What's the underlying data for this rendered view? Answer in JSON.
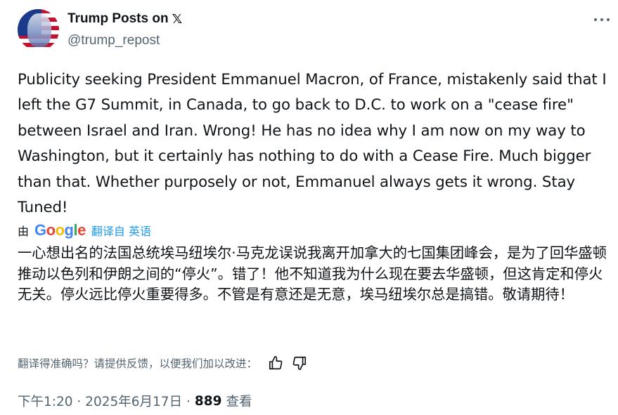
{
  "author": {
    "name": "Trump Posts on",
    "x_logo": "𝕏",
    "handle": "@trump_repost"
  },
  "post": {
    "text": "Publicity seeking President Emmanuel Macron, of France, mistakenly said that I left the G7 Summit, in Canada, to go back to D.C. to work on a \"cease fire\" between Israel and Iran. Wrong! He has no idea why I am now on my way to Washington, but it certainly has nothing to do with a Cease Fire. Much bigger than that. Whether purposely or not, Emmanuel always gets it wrong. Stay Tuned!"
  },
  "translation": {
    "by": "由",
    "provider_letters": [
      "G",
      "o",
      "o",
      "g",
      "l",
      "e"
    ],
    "link": "翻译自 英语",
    "text": "一心想出名的法国总统埃马纽埃尔·马克龙误说我离开加拿大的七国集团峰会，是为了回华盛顿推动以色列和伊朗之间的“停火”。错了！他不知道我为什么现在要去华盛顿，但这肯定和停火无关。停火远比停火重要得多。不管是有意还是无意，埃马纽埃尔总是搞错。敬请期待！",
    "feedback_prompt": "翻译得准确吗？请提供反馈，以便我们加以改进："
  },
  "meta": {
    "time": "下午1:20 · 2025年6月17日 ·",
    "views": "889",
    "views_label": "查看"
  },
  "icons": {
    "more": "more-horizontal-icon",
    "thumbs_up": "thumbs-up-icon",
    "thumbs_down": "thumbs-down-icon"
  },
  "colors": {
    "text": "#0f1419",
    "secondary": "#536471",
    "link": "#1d9bf0",
    "google_blue": "#4285F4",
    "google_red": "#EA4335",
    "google_yellow": "#FBBC05",
    "google_green": "#34A853"
  }
}
